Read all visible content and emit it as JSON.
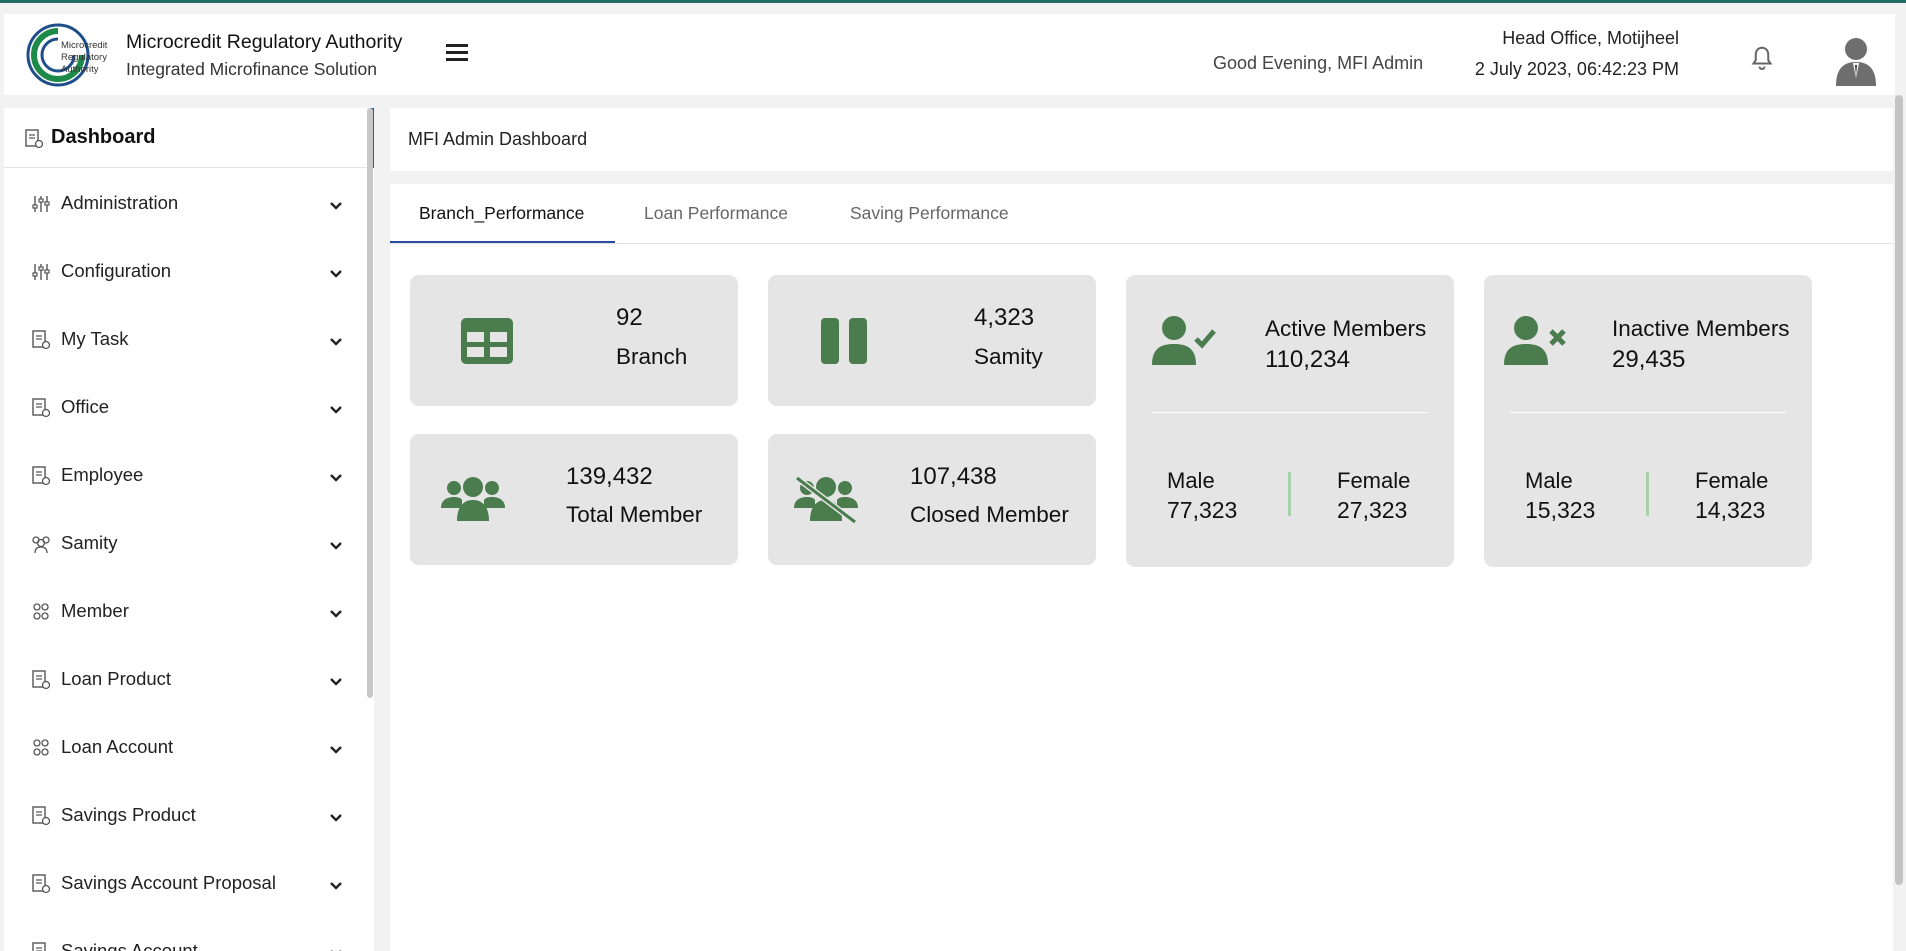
{
  "header": {
    "logo_text": [
      "Microcredit",
      "Regulatory",
      "Authority"
    ],
    "title": "Microcredit Regulatory Authority",
    "subtitle": "Integrated Microfinance Solution",
    "greeting": "Good Evening, MFI Admin",
    "office": "Head Office, Motijheel",
    "datetime": "2 July 2023, 06:42:23 PM"
  },
  "sidebar": {
    "dashboard_label": "Dashboard",
    "items": [
      {
        "label": "Administration",
        "icon": "sliders-icon"
      },
      {
        "label": "Configuration",
        "icon": "sliders-icon"
      },
      {
        "label": "My Task",
        "icon": "document-icon"
      },
      {
        "label": "Office",
        "icon": "document-icon"
      },
      {
        "label": "Employee",
        "icon": "document-icon"
      },
      {
        "label": "Samity",
        "icon": "group-icon"
      },
      {
        "label": "Member",
        "icon": "members-icon"
      },
      {
        "label": "Loan Product",
        "icon": "document-icon"
      },
      {
        "label": "Loan Account",
        "icon": "members-icon"
      },
      {
        "label": "Savings Product",
        "icon": "document-icon"
      },
      {
        "label": "Savings Account Proposal",
        "icon": "document-icon"
      },
      {
        "label": "Savings Account",
        "icon": "document-icon"
      }
    ]
  },
  "breadcrumb": "MFI Admin Dashboard",
  "tabs": [
    "Branch_Performance",
    "Loan Performance",
    "Saving Performance"
  ],
  "active_tab": "Branch_Performance",
  "accent_color": "#4a7c4e",
  "cards": {
    "branch": {
      "value": "92",
      "label": "Branch"
    },
    "samity": {
      "value": "4,323",
      "label": "Samity"
    },
    "total_member": {
      "value": "139,432",
      "label": "Total Member"
    },
    "closed_member": {
      "value": "107,438",
      "label": "Closed Member"
    },
    "active_members": {
      "label": "Active Members",
      "value": "110,234",
      "male_label": "Male",
      "male_value": "77,323",
      "female_label": "Female",
      "female_value": "27,323"
    },
    "inactive_members": {
      "label": "Inactive Members",
      "value": "29,435",
      "male_label": "Male",
      "male_value": "15,323",
      "female_label": "Female",
      "female_value": "14,323"
    }
  }
}
